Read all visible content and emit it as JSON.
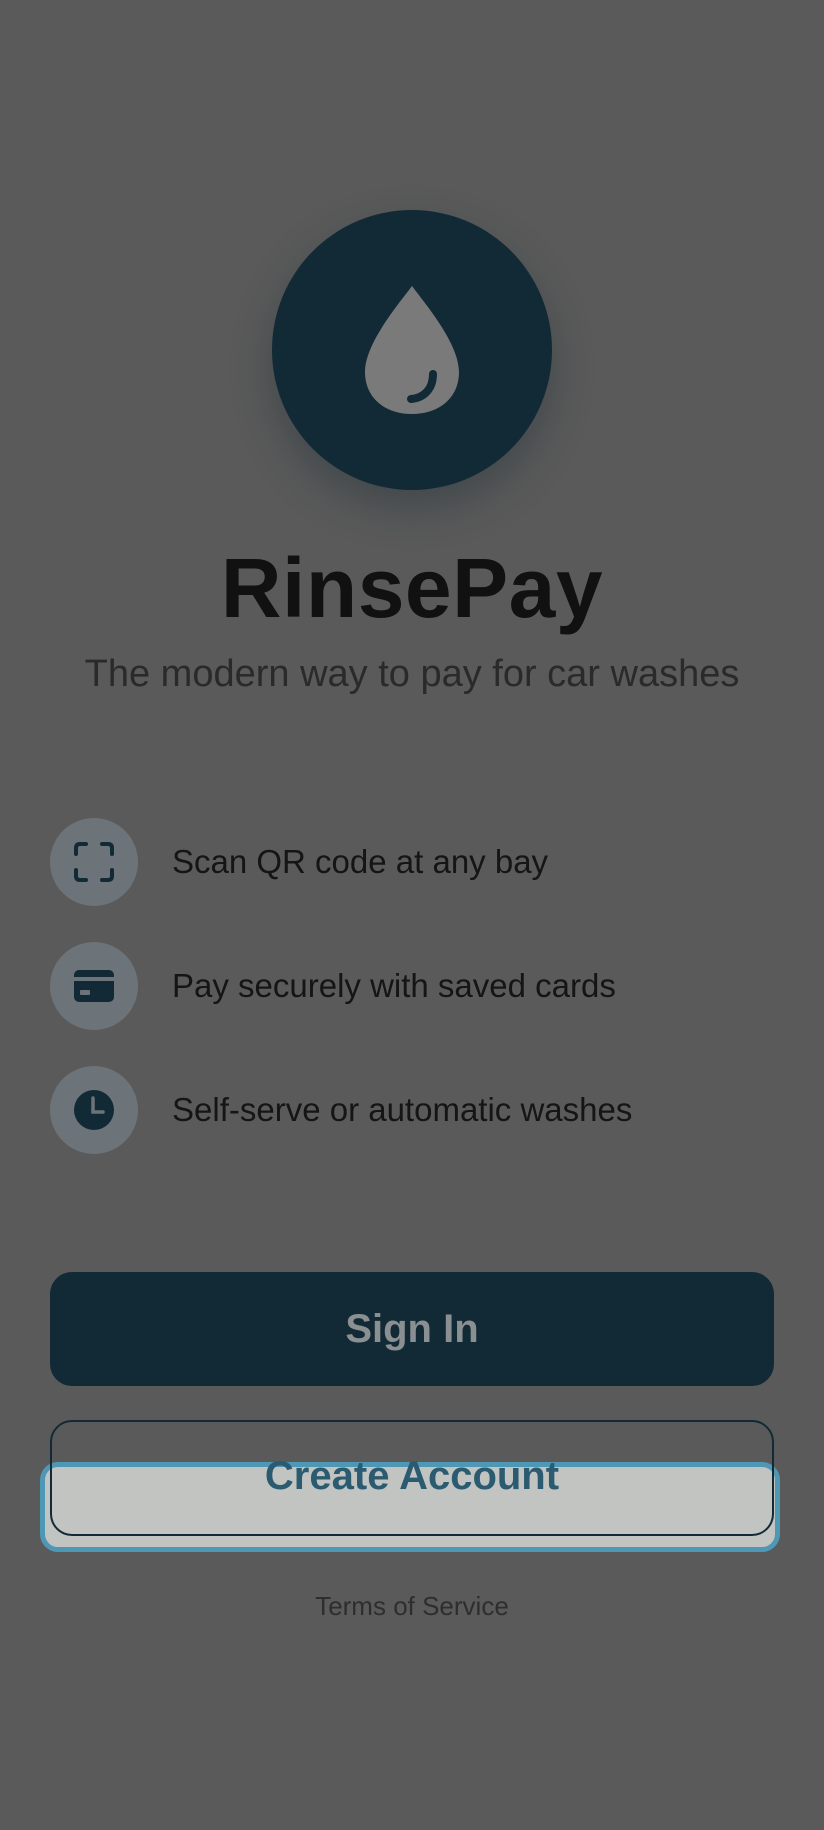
{
  "app": {
    "title": "RinsePay",
    "subtitle": "The modern way to pay for car washes"
  },
  "features": [
    {
      "icon": "qr-scan-icon",
      "label": "Scan QR code at any bay"
    },
    {
      "icon": "credit-card-icon",
      "label": "Pay securely with saved cards"
    },
    {
      "icon": "clock-icon",
      "label": "Self-serve or automatic washes"
    }
  ],
  "actions": {
    "sign_in_label": "Sign In",
    "create_account_label": "Create Account",
    "terms_label": "Terms of Service"
  },
  "colors": {
    "background": "#5a5a5a",
    "brand_dark": "#122a35",
    "highlight": "#4f98b5",
    "create_text": "#2b5b70"
  },
  "logo_icon": "water-drop-icon"
}
